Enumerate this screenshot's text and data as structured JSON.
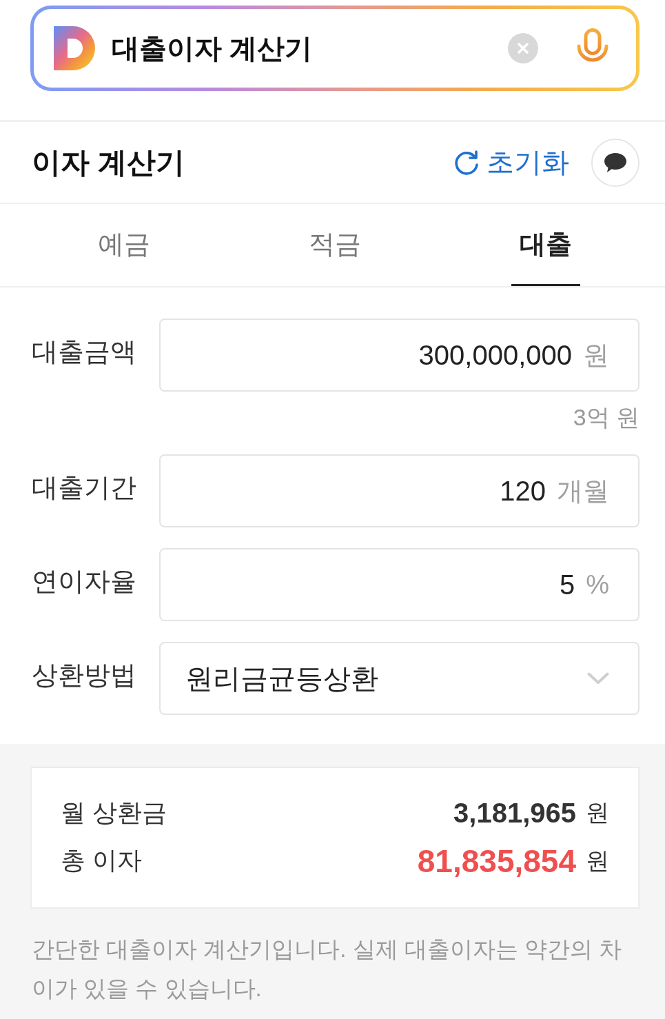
{
  "search": {
    "query": "대출이자 계산기"
  },
  "header": {
    "title": "이자 계산기",
    "reset_label": "초기화"
  },
  "tabs": [
    {
      "label": "예금",
      "selected": false
    },
    {
      "label": "적금",
      "selected": false
    },
    {
      "label": "대출",
      "selected": true
    }
  ],
  "fields": [
    {
      "kind": "input",
      "label": "대출금액",
      "value": "300,000,000",
      "unit": "원",
      "hint": "3억 원"
    },
    {
      "kind": "input",
      "label": "대출기간",
      "value": "120",
      "unit": "개월"
    },
    {
      "kind": "input",
      "label": "연이자율",
      "value": "5",
      "unit": "%"
    },
    {
      "kind": "select",
      "label": "상환방법",
      "value": "원리금균등상환"
    }
  ],
  "results": [
    {
      "kind": "normal",
      "label": "월 상환금",
      "value": "3,181,965",
      "unit": "원"
    },
    {
      "kind": "emphasis",
      "label": "총 이자",
      "value": "81,835,854",
      "unit": "원"
    }
  ],
  "note": "간단한 대출이자 계산기입니다. 실제 대출이자는 약간의 차이가 있을 수 있습니다."
}
